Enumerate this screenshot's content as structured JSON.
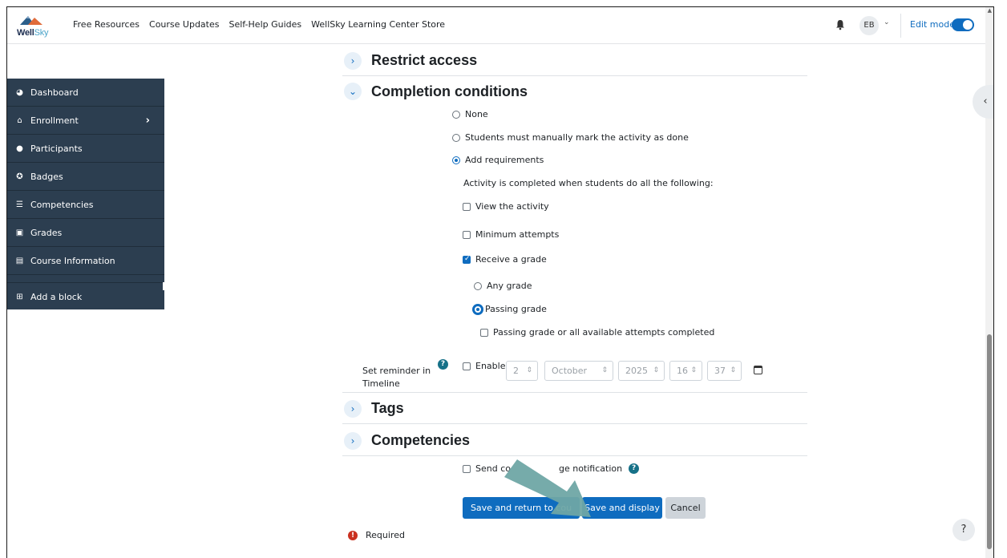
{
  "header": {
    "logo_text_a": "Well",
    "logo_text_b": "Sky",
    "nav": [
      "Free Resources",
      "Course Updates",
      "Self-Help Guides",
      "WellSky Learning Center Store"
    ],
    "avatar_initials": "EB",
    "edit_mode_label": "Edit mode",
    "edit_mode_on": true
  },
  "drawer": {
    "items": [
      {
        "label": "Dashboard",
        "icon": "dashboard-icon"
      },
      {
        "label": "Enrollment",
        "icon": "bank-icon"
      },
      {
        "label": "Participants",
        "icon": "users-icon"
      },
      {
        "label": "Badges",
        "icon": "badge-icon"
      },
      {
        "label": "Competencies",
        "icon": "list-icon"
      },
      {
        "label": "Grades",
        "icon": "grades-icon"
      },
      {
        "label": "Course Information",
        "icon": "info-card-icon"
      }
    ],
    "add_block": "Add a block"
  },
  "sections": {
    "restrict_access": "Restrict access",
    "completion_conditions": "Completion conditions",
    "tags": "Tags",
    "competencies": "Competencies"
  },
  "completion": {
    "none": "None",
    "manual": "Students must manually mark the activity as done",
    "add_requirements": "Add requirements",
    "description": "Activity is completed when students do all the following:",
    "view_activity": "View the activity",
    "min_attempts": "Minimum attempts",
    "receive_grade": "Receive a grade",
    "any_grade": "Any grade",
    "passing_grade": "Passing grade",
    "passing_or_all": "Passing grade or all available attempts completed"
  },
  "reminder": {
    "label": "Set reminder in Timeline",
    "enable": "Enable",
    "day": "2",
    "month": "October",
    "year": "2025",
    "hour": "16",
    "minute": "37"
  },
  "notification": {
    "label_start": "Send co",
    "label_end": "ge notification"
  },
  "buttons": {
    "save_return": "Save and return to cou",
    "save_display": "Save and display",
    "cancel": "Cancel"
  },
  "required_label": "Required",
  "colors": {
    "primary": "#0f6cbf",
    "drawer_bg": "#2c3e50",
    "arrow": "#6fa7a5",
    "required": "#ca3120"
  }
}
